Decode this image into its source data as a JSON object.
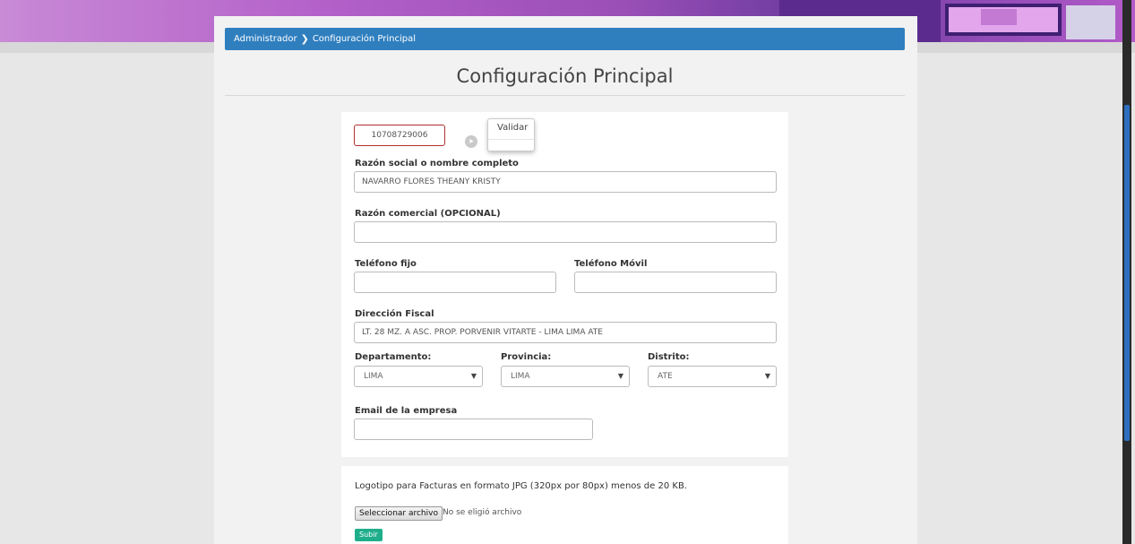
{
  "breadcrumb": {
    "root": "Administrador",
    "current": "Configuración Principal"
  },
  "page": {
    "title": "Configuración Principal"
  },
  "form": {
    "ruc_value": "10708729006",
    "validate_tooltip": "Validar",
    "razon_social_label": "Razón social o nombre completo",
    "razon_social_value": "NAVARRO FLORES THEANY KRISTY",
    "razon_comercial_label": "Razón comercial (OPCIONAL)",
    "razon_comercial_value": "",
    "telefono_fijo_label": "Teléfono fijo",
    "telefono_fijo_value": "",
    "telefono_movil_label": "Teléfono Móvil",
    "telefono_movil_value": "",
    "direccion_label": "Dirección Fiscal",
    "direccion_value": "LT. 28 MZ. A ASC. PROP. PORVENIR VITARTE - LIMA LIMA ATE",
    "departamento_label": "Departamento:",
    "departamento_value": "LIMA",
    "provincia_label": "Provincia:",
    "provincia_value": "LIMA",
    "distrito_label": "Distrito:",
    "distrito_value": "ATE",
    "email_label": "Email de la empresa",
    "email_value": ""
  },
  "logo": {
    "description": "Logotipo para Facturas en formato JPG (320px por 80px) menos de 20 KB.",
    "file_button": "Seleccionar archivo",
    "file_status": "No se eligió archivo",
    "upload_button": "Subir"
  },
  "colors": {
    "breadcrumb_bg": "#2f7fbf",
    "ruc_border": "#b03030",
    "upload_bg": "#1fae8b"
  }
}
